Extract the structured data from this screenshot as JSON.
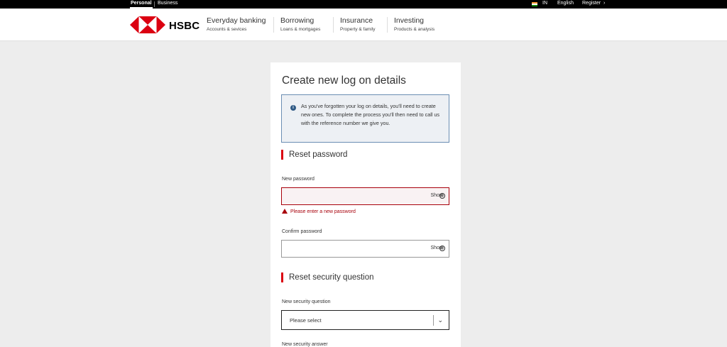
{
  "topbar": {
    "personal": "Personal",
    "business": "Business",
    "region": "IN",
    "language": "English",
    "register": "Register",
    "flag_icon": "india-flag-icon",
    "chevron_icon": "chevron-right-icon"
  },
  "header": {
    "logo_text": "HSBC",
    "nav": [
      {
        "title": "Everyday banking",
        "sub": "Accounts & sevices"
      },
      {
        "title": "Borrowing",
        "sub": "Loans & mortgages"
      },
      {
        "title": "Insurance",
        "sub": "Property & family"
      },
      {
        "title": "Investing",
        "sub": "Products & analysis"
      }
    ]
  },
  "form": {
    "title": "Create new log on details",
    "info": "As you've forgotten your log on details, you'll need to create new ones. To complete the process you'll then need to call us with the reference number we give you.",
    "section_password": "Reset password",
    "new_password_label": "New password",
    "confirm_password_label": "Confirm password",
    "show_label": "Show",
    "error_new_password": "Please enter a new password",
    "section_security": "Reset security question",
    "security_question_label": "New security question",
    "security_question_value": "Please select",
    "security_answer_label": "New security answer"
  },
  "colors": {
    "brand_red": "#db0011",
    "error_red": "#a8000b",
    "info_border": "#6b8eb3",
    "page_bg": "#ededed"
  }
}
